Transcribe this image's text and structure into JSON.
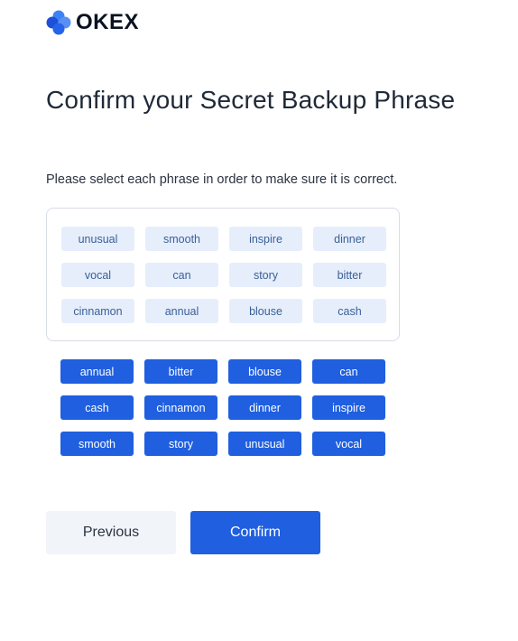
{
  "brand": {
    "name": "OKEX",
    "colors": {
      "logo_dark": "#1d4fd8",
      "logo_mid": "#3b82f6",
      "logo_light": "#93c5fd",
      "primary": "#1f5fe0"
    }
  },
  "page": {
    "title": "Confirm your Secret Backup Phrase",
    "instructions": "Please select each phrase in order to make sure it is correct."
  },
  "selected_phrases": [
    "unusual",
    "smooth",
    "inspire",
    "dinner",
    "vocal",
    "can",
    "story",
    "bitter",
    "cinnamon",
    "annual",
    "blouse",
    "cash"
  ],
  "word_options": [
    "annual",
    "bitter",
    "blouse",
    "can",
    "cash",
    "cinnamon",
    "dinner",
    "inspire",
    "smooth",
    "story",
    "unusual",
    "vocal"
  ],
  "buttons": {
    "previous": "Previous",
    "confirm": "Confirm"
  }
}
